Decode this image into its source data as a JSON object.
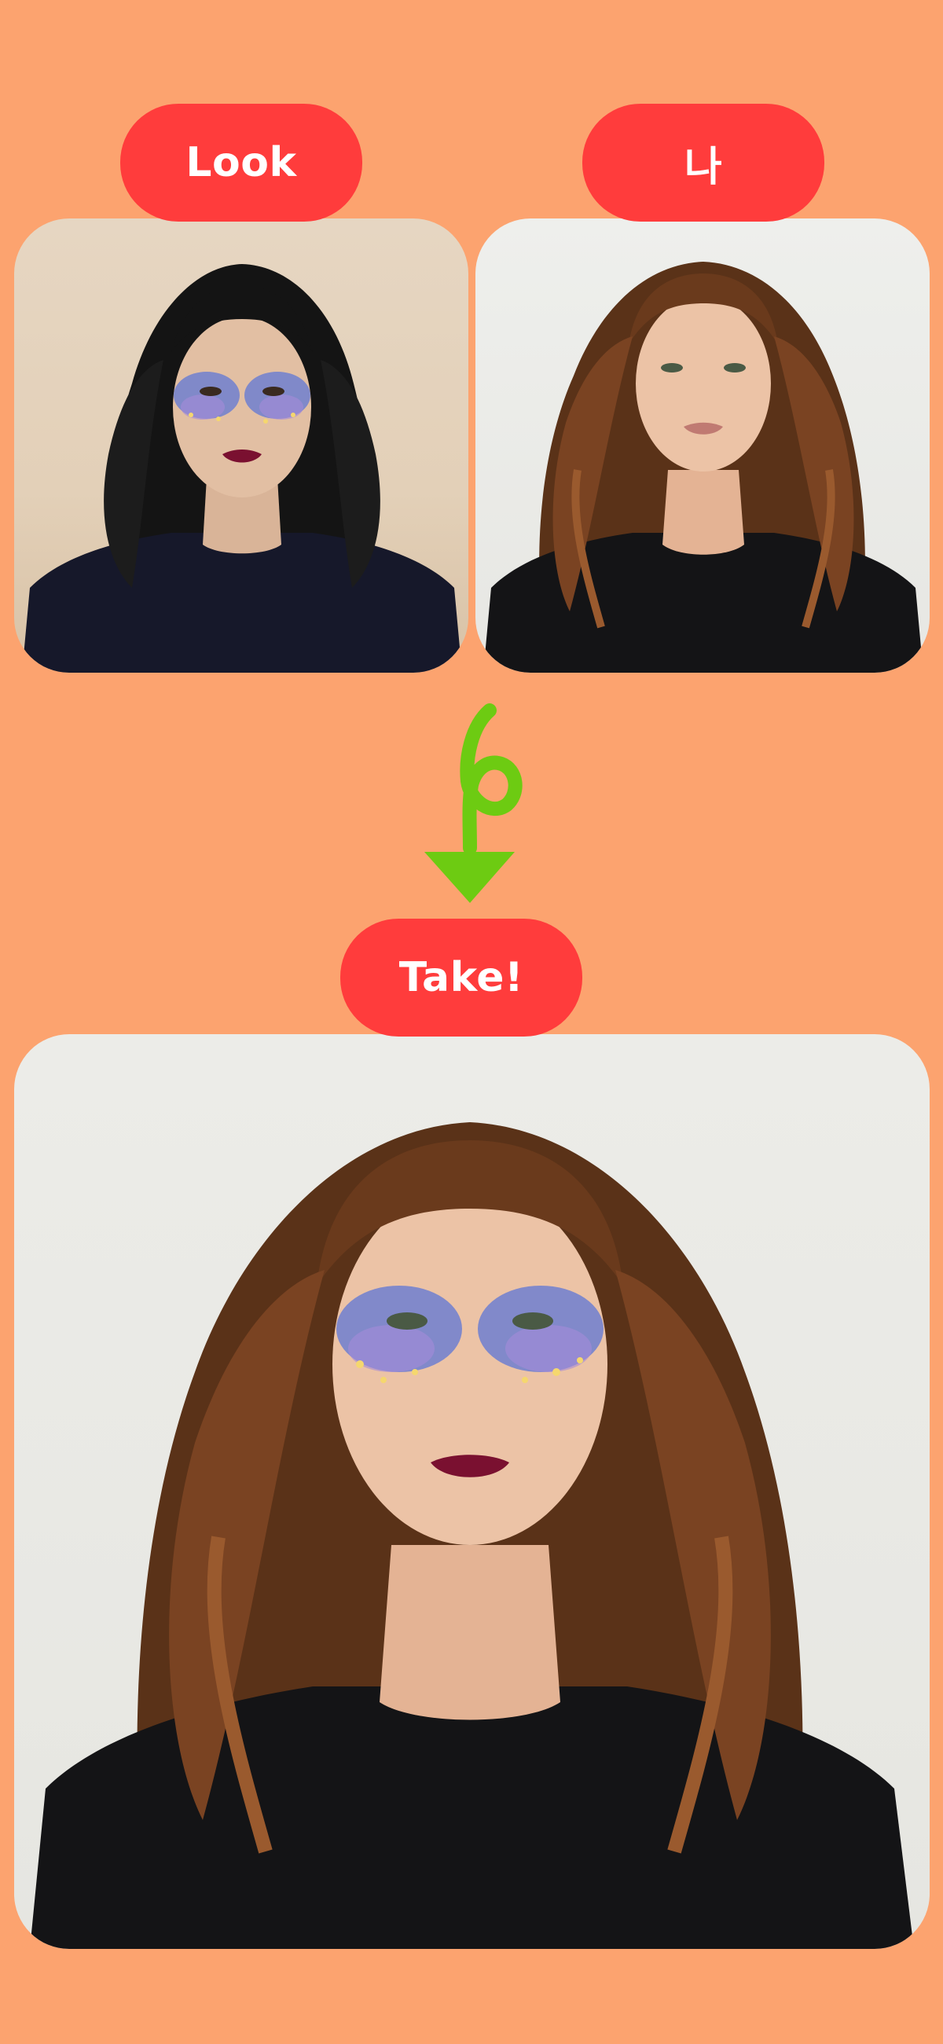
{
  "labels": {
    "look": "Look",
    "me": "나",
    "take": "Take!"
  },
  "photos": {
    "look": "portrait-dark-hair-galaxy-makeup",
    "me": "portrait-auburn-wavy-hair-natural",
    "result": "portrait-auburn-wavy-hair-galaxy-makeup"
  },
  "icons": {
    "arrow": "hand-drawn-down-arrow-icon"
  },
  "colors": {
    "background": "#FCA36F",
    "pill": "#FF3C3C",
    "pill_text": "#FFFFFF",
    "arrow": "#6DCB12"
  }
}
